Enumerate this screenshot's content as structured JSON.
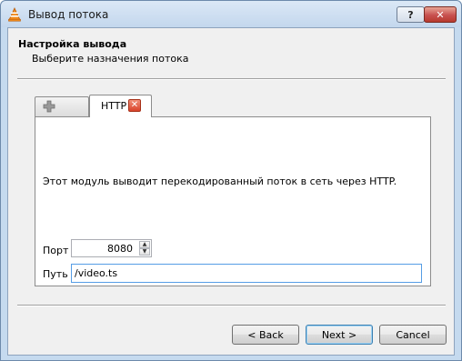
{
  "window": {
    "title": "Вывод потока",
    "help_label": "?",
    "close_label": "✕"
  },
  "header": {
    "title": "Настройка вывода",
    "subtitle": "Выберите назначения потока"
  },
  "tabs": {
    "add_icon": "plus-icon",
    "active_label": "HTTP",
    "close_label": "✕"
  },
  "http": {
    "description": "Этот модуль выводит перекодированный поток в сеть через HTTP.",
    "port_label": "Порт",
    "port_value": "8080",
    "path_label": "Путь",
    "path_value": "/video.ts"
  },
  "footer": {
    "back_label": "< Back",
    "next_label": "Next >",
    "cancel_label": "Cancel"
  },
  "colors": {
    "window_frame": "#c5daef",
    "close_button": "#c75050",
    "focus_border": "#569de5"
  }
}
